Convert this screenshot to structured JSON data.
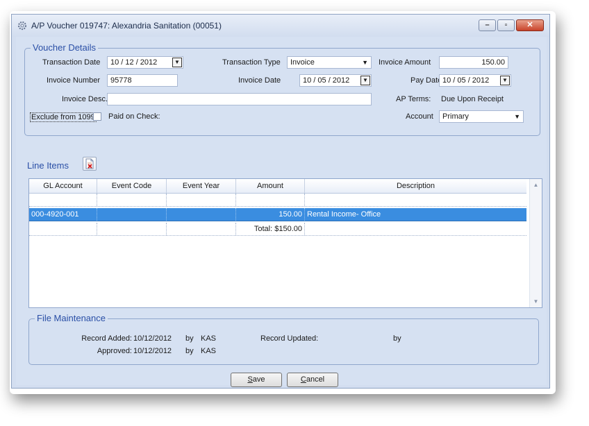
{
  "window": {
    "title": "A/P Voucher 019747: Alexandria Sanitation (00051)",
    "min_glyph": "–",
    "max_glyph": "▫",
    "close_glyph": "✕"
  },
  "voucher": {
    "legend": "Voucher Details",
    "transaction_date_label": "Transaction Date",
    "transaction_date": "10 / 12 / 2012",
    "transaction_type_label": "Transaction Type",
    "transaction_type": "Invoice",
    "invoice_amount_label": "Invoice Amount",
    "invoice_amount": "150.00",
    "invoice_number_label": "Invoice Number",
    "invoice_number": "95778",
    "invoice_date_label": "Invoice Date",
    "invoice_date": "10 / 05 / 2012",
    "pay_date_label": "Pay Date",
    "pay_date": "10 / 05 / 2012",
    "invoice_desc_label": "Invoice Desc.",
    "invoice_desc": "",
    "ap_terms_label": "AP Terms:",
    "ap_terms": "Due Upon Receipt",
    "exclude_label": "Exclude from 1099",
    "paid_on_check_label": "Paid on Check:",
    "account_label": "Account",
    "account": "Primary"
  },
  "line_items": {
    "label": "Line Items",
    "columns": [
      "GL Account",
      "Event Code",
      "Event Year",
      "Amount",
      "Description"
    ],
    "rows": [
      {
        "gl": "",
        "event_code": "",
        "event_year": "",
        "amount": "",
        "description": ""
      },
      {
        "gl": "000-4920-001",
        "event_code": "",
        "event_year": "",
        "amount": "150.00",
        "description": "Rental Income- Office"
      },
      {
        "gl": "",
        "event_code": "",
        "event_year": "",
        "amount": "Total: $150.00",
        "description": ""
      }
    ]
  },
  "file_maintenance": {
    "legend": "File Maintenance",
    "record_added_label": "Record Added:",
    "record_added": "10/12/2012",
    "added_by_label": "by",
    "added_by": "KAS",
    "record_updated_label": "Record Updated:",
    "record_updated": "",
    "updated_by_label": "by",
    "updated_by": "",
    "approved_label": "Approved:",
    "approved": "10/12/2012",
    "approved_by_label": "by",
    "approved_by": "KAS"
  },
  "buttons": {
    "save_u": "S",
    "save_rest": "ave",
    "cancel_u": "C",
    "cancel_rest": "ancel"
  },
  "colors": {
    "accent": "#2a4fa6",
    "selection": "#3a8de0",
    "window_bg": "#d6e1f2"
  }
}
